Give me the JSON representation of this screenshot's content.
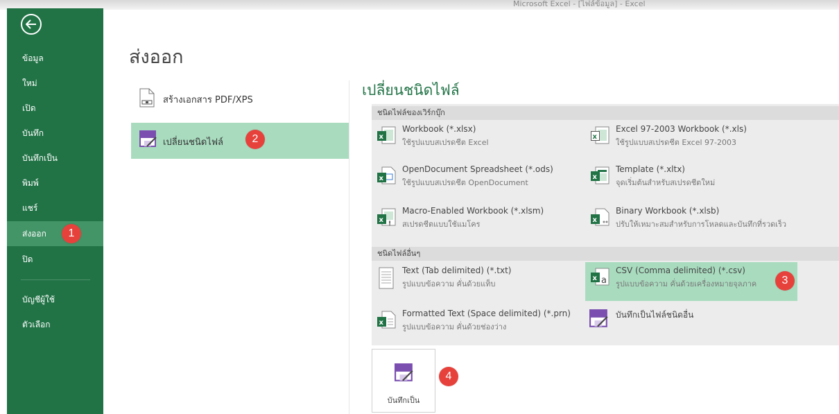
{
  "window": {
    "title": "Microsoft Excel - [ไฟล์ข้อมูล] - Excel"
  },
  "sidebar": {
    "back_icon": "arrow-left-circle-icon",
    "items": [
      {
        "label": "ข้อมูล"
      },
      {
        "label": "ใหม่"
      },
      {
        "label": "เปิด"
      },
      {
        "label": "บันทึก"
      },
      {
        "label": "บันทึกเป็น"
      },
      {
        "label": "พิมพ์"
      },
      {
        "label": "แชร์"
      },
      {
        "label": "ส่งออก",
        "active": true
      },
      {
        "label": "ปิด"
      },
      {
        "label": "บัญชีผู้ใช้"
      },
      {
        "label": "ตัวเลือก"
      }
    ],
    "colors": {
      "background": "#217346",
      "active": "#439467"
    }
  },
  "main": {
    "title": "ส่งออก",
    "options": [
      {
        "label": "สร้างเอกสาร PDF/XPS",
        "icon": "pdf-document-icon"
      },
      {
        "label": "เปลี่ยนชนิดไฟล์",
        "icon": "change-file-type-icon",
        "selected": true
      }
    ]
  },
  "change_type": {
    "title": "เปลี่ยนชนิดไฟล์",
    "workbook_section": "ชนิดไฟล์ของเวิร์กบุ๊ก",
    "workbook_types": [
      {
        "name": "Workbook (*.xlsx)",
        "desc": "ใช้รูปแบบสเปรดชีต Excel",
        "icon": "excel-workbook-icon"
      },
      {
        "name": "Excel 97-2003 Workbook (*.xls)",
        "desc": "ใช้รูปแบบสเปรดชีต Excel 97-2003",
        "icon": "excel-legacy-icon"
      },
      {
        "name": "OpenDocument Spreadsheet (*.ods)",
        "desc": "ใช้รูปแบบสเปรดชีต OpenDocument",
        "icon": "opendocument-icon"
      },
      {
        "name": "Template (*.xltx)",
        "desc": "จุดเริ่มต้นสำหรับสเปรดชีตใหม่",
        "icon": "excel-template-icon"
      },
      {
        "name": "Macro-Enabled Workbook (*.xlsm)",
        "desc": "สเปรดชีตแบบใช้แมโคร",
        "icon": "macro-workbook-icon"
      },
      {
        "name": "Binary Workbook (*.xlsb)",
        "desc": "ปรับให้เหมาะสมสำหรับการโหลดและบันทึกที่รวดเร็ว",
        "icon": "binary-workbook-icon"
      }
    ],
    "other_section": "ชนิดไฟล์อื่นๆ",
    "other_types": [
      {
        "name": "Text (Tab delimited) (*.txt)",
        "desc": "รูปแบบข้อความ คั่นด้วยแท็บ",
        "icon": "text-file-icon"
      },
      {
        "name": "CSV (Comma delimited) (*.csv)",
        "desc": "รูปแบบข้อความ คั่นด้วยเครื่องหมายจุลภาค",
        "icon": "csv-file-icon",
        "highlighted": true
      },
      {
        "name": "Formatted Text (Space delimited) (*.prn)",
        "desc": "รูปแบบข้อความ คั่นด้วยช่องว่าง",
        "icon": "formatted-text-icon"
      },
      {
        "name": "บันทึกเป็นไฟล์ชนิดอื่น",
        "desc": "",
        "icon": "save-as-other-icon"
      }
    ],
    "save_as_label": "บันทึกเป็น",
    "accent": "#217346",
    "highlight": "#a9dcbf"
  },
  "badges": [
    "1",
    "2",
    "3",
    "4"
  ]
}
